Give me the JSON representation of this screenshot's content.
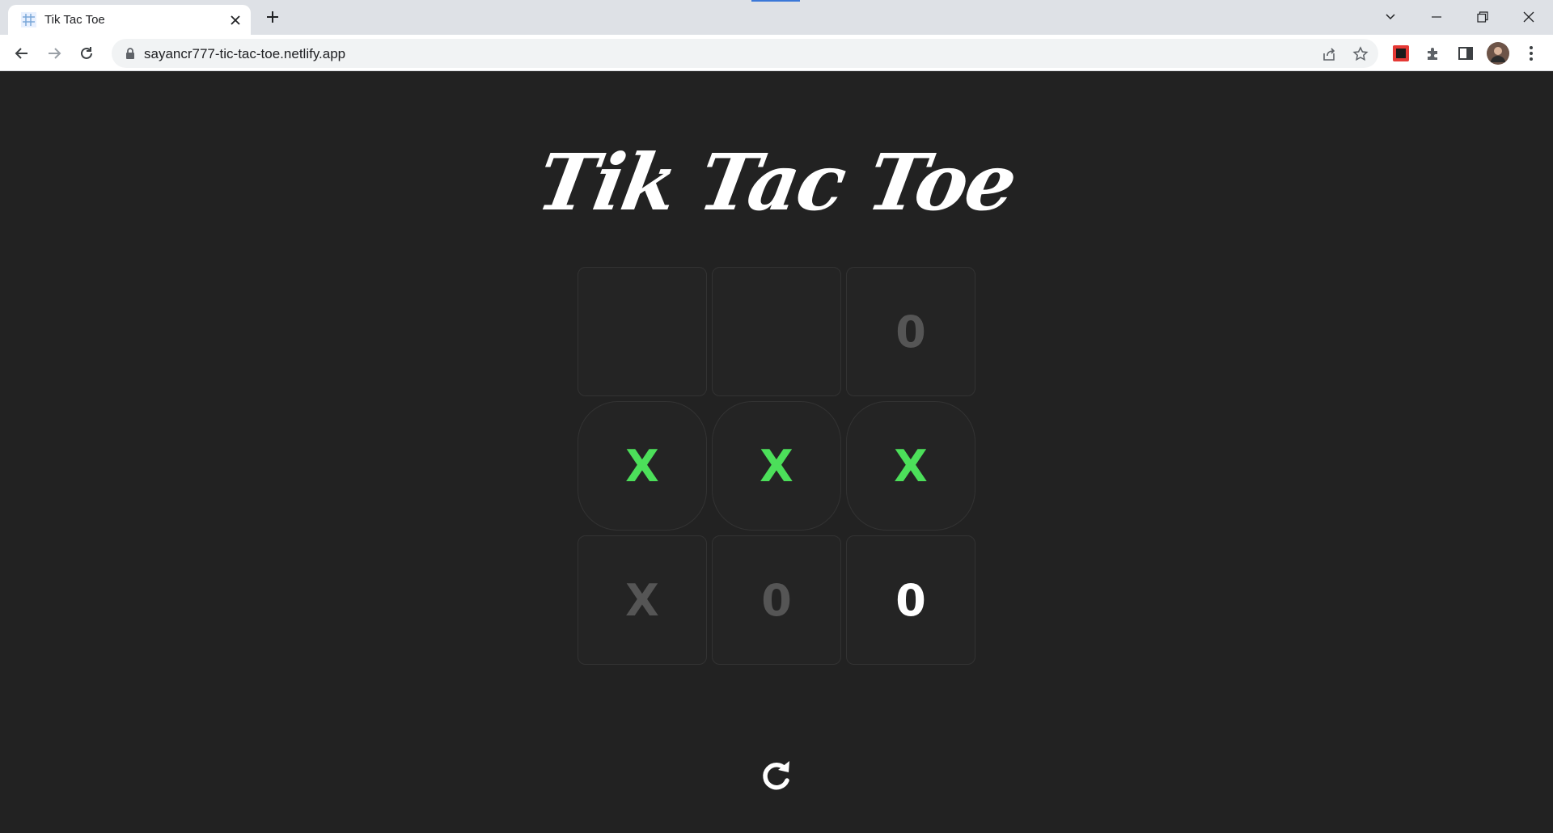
{
  "browser": {
    "tab_title": "Tik Tac Toe",
    "url": "sayancr777-tic-tac-toe.netlify.app"
  },
  "game": {
    "title": "Tik Tac Toe",
    "cells": [
      "",
      "",
      "0",
      "X",
      "X",
      "X",
      "X",
      "0",
      "0"
    ],
    "cell_styles": [
      "dim",
      "dim",
      "dim",
      "green",
      "green",
      "green",
      "dim",
      "dim",
      "white"
    ],
    "winning_cells": [
      3,
      4,
      5
    ],
    "colors": {
      "background": "#222222",
      "win": "#4cdf5a",
      "dim_mark": "#555555",
      "last_move": "#ffffff"
    }
  },
  "icons": {
    "reset": "reset-icon"
  }
}
